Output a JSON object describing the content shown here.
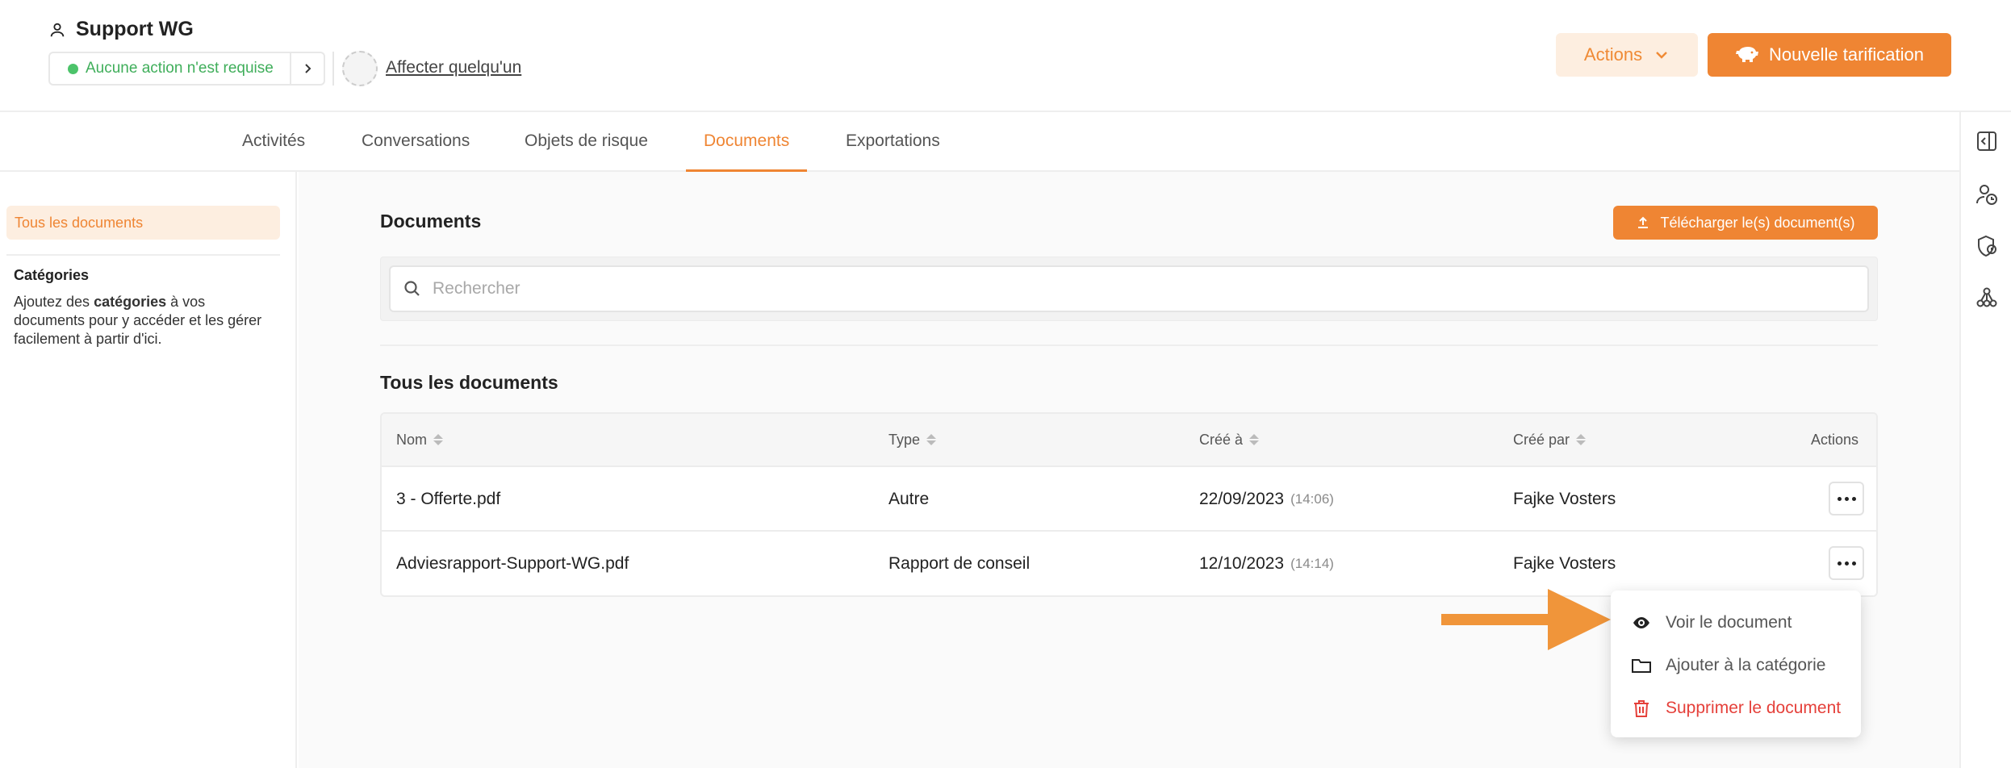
{
  "header": {
    "client_name": "Support WG",
    "status": "Aucune action n'est requise",
    "assign_label": "Affecter quelqu'un",
    "actions_label": "Actions",
    "new_pricing_label": "Nouvelle tarification"
  },
  "tabs": [
    {
      "label": "Activités"
    },
    {
      "label": "Conversations"
    },
    {
      "label": "Objets de risque"
    },
    {
      "label": "Documents",
      "active": true
    },
    {
      "label": "Exportations"
    }
  ],
  "sidebar": {
    "active_item": "Tous les documents",
    "categories_title": "Catégories",
    "desc_prefix": "Ajoutez des ",
    "desc_bold": "catégories",
    "desc_suffix": " à vos documents pour y accéder et les gérer facilement à partir d'ici."
  },
  "main": {
    "title": "Documents",
    "upload_label": "Télécharger le(s) document(s)",
    "search_placeholder": "Rechercher",
    "section_title": "Tous les documents",
    "columns": {
      "name": "Nom",
      "type": "Type",
      "created_at": "Créé à",
      "created_by": "Créé par",
      "actions": "Actions"
    },
    "rows": [
      {
        "name": "3 - Offerte.pdf",
        "type": "Autre",
        "date": "22/09/2023",
        "time": "(14:06)",
        "author": "Fajke Vosters"
      },
      {
        "name": "Adviesrapport-Support-WG.pdf",
        "type": "Rapport de conseil",
        "date": "12/10/2023",
        "time": "(14:14)",
        "author": "Fajke Vosters"
      }
    ]
  },
  "menu": {
    "view": "Voir le document",
    "add_category": "Ajouter à la catégorie",
    "delete": "Supprimer le document"
  },
  "colors": {
    "accent": "#ef8533",
    "accent_light": "#fdeee0",
    "success": "#4cc36a",
    "danger": "#e5403a"
  }
}
